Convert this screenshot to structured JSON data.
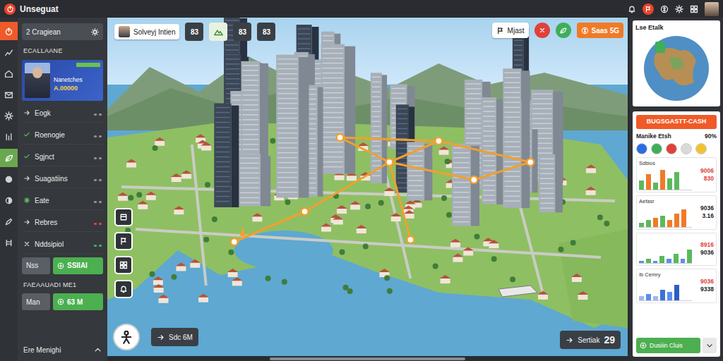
{
  "app": {
    "title": "Unseguat"
  },
  "rail": {
    "items": [
      {
        "kind": "power",
        "selected": true,
        "highlighted": false
      },
      {
        "kind": "chart",
        "selected": false,
        "highlighted": false
      },
      {
        "kind": "home",
        "selected": false,
        "highlighted": false
      },
      {
        "kind": "mail",
        "selected": false,
        "highlighted": false
      },
      {
        "kind": "gear",
        "selected": false,
        "highlighted": false
      },
      {
        "kind": "bars",
        "selected": false,
        "highlighted": false
      },
      {
        "kind": "leaf",
        "selected": false,
        "highlighted": true
      },
      {
        "kind": "dot",
        "selected": false,
        "highlighted": false
      },
      {
        "kind": "half",
        "selected": false,
        "highlighted": false
      },
      {
        "kind": "pen",
        "selected": false,
        "highlighted": false
      },
      {
        "kind": "gate",
        "selected": false,
        "highlighted": false
      }
    ]
  },
  "sidebar": {
    "header": {
      "label": "2 Cragiean"
    },
    "section": "ECALLAANE",
    "profile": {
      "name": "Nanetches",
      "amount": "A.00000"
    },
    "items": [
      {
        "label": "Eogk",
        "kind": "arrow",
        "color": "#8a8d91"
      },
      {
        "label": "Roenogie",
        "kind": "check",
        "color": "#8a8d91"
      },
      {
        "label": "Sgjnct",
        "kind": "check",
        "color": "#8a8d91"
      },
      {
        "label": "Suagatiins",
        "kind": "arrow",
        "color": "#8a8d91"
      },
      {
        "label": "Eate",
        "kind": "star",
        "color": "#8a8d91"
      },
      {
        "label": "Rebres",
        "kind": "arrow",
        "color": "#e0413a"
      },
      {
        "label": "Nddsipiol",
        "kind": "x",
        "color": "#3fae5a"
      }
    ],
    "balance": {
      "label": "Nss",
      "value": "SSIIAI"
    },
    "section2": {
      "title": "FAEAAUADI ME1",
      "label": "Man",
      "value": "63 M"
    },
    "footer": {
      "label": "Ere Menighi",
      "expanded": true
    }
  },
  "map": {
    "player": {
      "name": "Solveyj Intien"
    },
    "top_buttons": [
      {
        "kind": "count",
        "label": "83"
      },
      {
        "kind": "toggle",
        "on": true
      },
      {
        "kind": "count",
        "label": "83"
      },
      {
        "kind": "count",
        "label": "83"
      }
    ],
    "top_right": {
      "chip": "Mjast",
      "cash": "Saas 5G"
    },
    "bottom_left": {
      "label": "Sdc 6M"
    },
    "bottom_right": {
      "label": "Sertiak",
      "value": "29"
    }
  },
  "right": {
    "minimap": {
      "title": "Lse Etalk"
    },
    "market": {
      "button": "BUGSGASTT-CASH",
      "title": "Manike Etsh",
      "percent": "90%",
      "filters": [
        {
          "color": "#2d6cdf"
        },
        {
          "color": "#3fae5a"
        },
        {
          "color": "#e0413a"
        },
        {
          "color": "#d9d9d9"
        },
        {
          "color": "#f2c230"
        }
      ],
      "charts": [
        {
          "label": "Sdbios",
          "values": [
            4,
            7,
            3,
            9,
            5,
            8
          ],
          "colors": [
            "#5cb85c",
            "#f07a28",
            "#5cb85c",
            "#f07a28",
            "#5cb85c",
            "#5cb85c"
          ],
          "readings": [
            {
              "text": "9006",
              "color": "#e0413a"
            },
            {
              "text": "830",
              "color": "#e0413a"
            }
          ]
        },
        {
          "label": "Aefasr",
          "values": [
            2,
            3,
            4,
            5,
            3,
            6,
            8
          ],
          "colors": [
            "#5cb85c",
            "#5cb85c",
            "#f07a28",
            "#5cb85c",
            "#f07a28",
            "#f07a28",
            "#f07a28"
          ],
          "readings": [
            {
              "text": "9036",
              "color": "#222222"
            },
            {
              "text": "3.16",
              "color": "#222222"
            }
          ]
        },
        {
          "values": [
            1,
            2,
            1,
            3,
            2,
            4,
            2,
            6
          ],
          "colors": [
            "#5b8def",
            "#5cb85c",
            "#5b8def",
            "#5cb85c",
            "#5b8def",
            "#5cb85c",
            "#5b8def",
            "#5cb85c"
          ],
          "readings": [
            {
              "text": "8916",
              "color": "#e0413a"
            },
            {
              "text": "9036",
              "color": "#222222"
            }
          ]
        },
        {
          "label": "Ib Cemry",
          "values": [
            2,
            3,
            2,
            5,
            4,
            7
          ],
          "colors": [
            "#9db8f0",
            "#5b8def",
            "#9db8f0",
            "#3f6fd8",
            "#5b8def",
            "#2d5cc8"
          ],
          "readings": [
            {
              "text": "9036",
              "color": "#e0413a"
            },
            {
              "text": "9338",
              "color": "#222222"
            }
          ]
        }
      ],
      "footer": {
        "label": "Dusiiin Cluis"
      }
    }
  }
}
